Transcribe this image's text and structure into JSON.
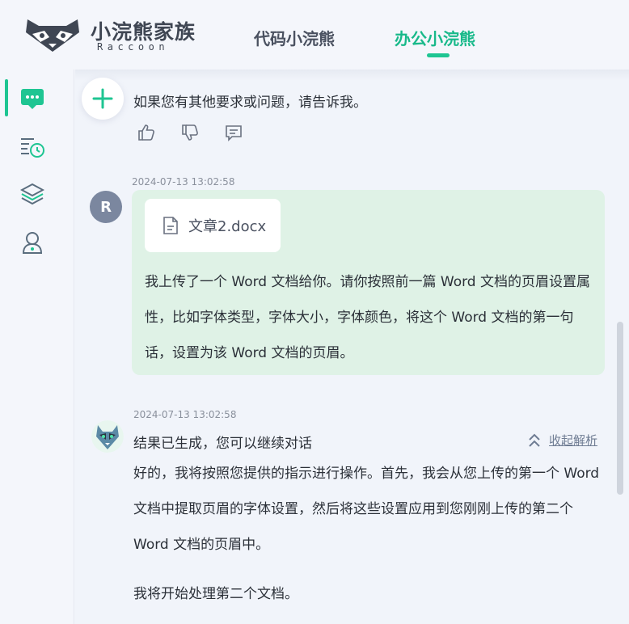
{
  "header": {
    "logo_title": "小浣熊家族",
    "logo_subtitle": "Raccoon",
    "tabs": [
      {
        "label": "代码小浣熊",
        "active": false
      },
      {
        "label": "办公小浣熊",
        "active": true
      }
    ]
  },
  "sidebar": {
    "items": [
      {
        "icon": "chat-icon",
        "active": true
      },
      {
        "icon": "history-icon",
        "active": false
      },
      {
        "icon": "layers-icon",
        "active": false
      },
      {
        "icon": "user-icon",
        "active": false
      }
    ]
  },
  "conversation": {
    "previous_reply": "如果您有其他要求或问题，请告诉我。",
    "feedback_icons": [
      "thumbs-up-icon",
      "thumbs-down-icon",
      "comment-icon"
    ],
    "user_message": {
      "timestamp": "2024-07-13 13:02:58",
      "avatar_letter": "R",
      "attachment": "文章2.docx",
      "text": "我上传了一个 Word 文档给你。请你按照前一篇 Word 文档的页眉设置属性，比如字体类型，字体大小，字体颜色，将这个 Word 文档的第一句话，设置为该 Word 文档的页眉。"
    },
    "bot_message": {
      "timestamp": "2024-07-13 13:02:58",
      "status": "结果已生成，您可以继续对话",
      "collapse_label": "收起解析",
      "paragraph1": "好的，我将按照您提供的指示进行操作。首先，我会从您上传的第一个 Word 文档中提取页眉的字体设置，然后将这些设置应用到您刚刚上传的第二个 Word 文档的页眉中。",
      "paragraph2": "我将开始处理第二个文档。"
    }
  },
  "colors": {
    "accent": "#1ec592",
    "user_bubble": "#dff2e6",
    "background": "#f4f6fb",
    "avatar": "#7b879f"
  }
}
